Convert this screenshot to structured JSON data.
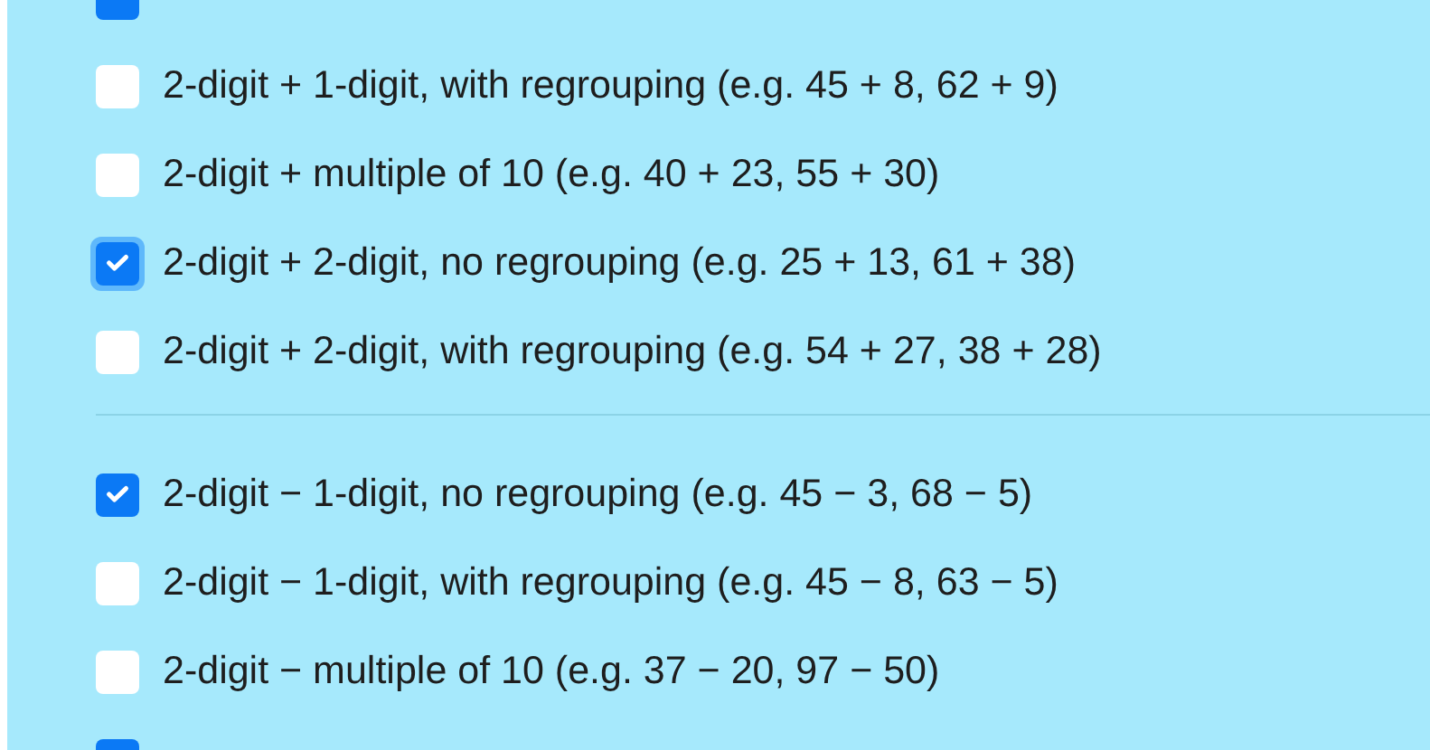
{
  "groups": [
    {
      "items": [
        {
          "kind": "cut",
          "checked": true,
          "focused": false
        },
        {
          "kind": "option",
          "label": "2-digit + 1-digit, with regrouping (e.g. 45 + 8, 62 + 9)",
          "checked": false,
          "focused": false
        },
        {
          "kind": "option",
          "label": "2-digit + multiple of 10 (e.g. 40 + 23, 55 + 30)",
          "checked": false,
          "focused": false
        },
        {
          "kind": "option",
          "label": "2-digit + 2-digit, no regrouping (e.g. 25 + 13, 61 + 38)",
          "checked": true,
          "focused": true
        },
        {
          "kind": "option",
          "label": "2-digit + 2-digit, with regrouping (e.g. 54 + 27, 38 + 28)",
          "checked": false,
          "focused": false
        }
      ]
    },
    {
      "items": [
        {
          "kind": "option",
          "label": "2-digit − 1-digit, no regrouping (e.g. 45 − 3, 68 − 5)",
          "checked": true,
          "focused": false
        },
        {
          "kind": "option",
          "label": "2-digit − 1-digit, with regrouping (e.g. 45 − 8, 63 − 5)",
          "checked": false,
          "focused": false
        },
        {
          "kind": "option",
          "label": "2-digit − multiple of 10 (e.g. 37 − 20, 97 − 50)",
          "checked": false,
          "focused": false
        },
        {
          "kind": "cut",
          "checked": true,
          "focused": false
        }
      ]
    }
  ]
}
